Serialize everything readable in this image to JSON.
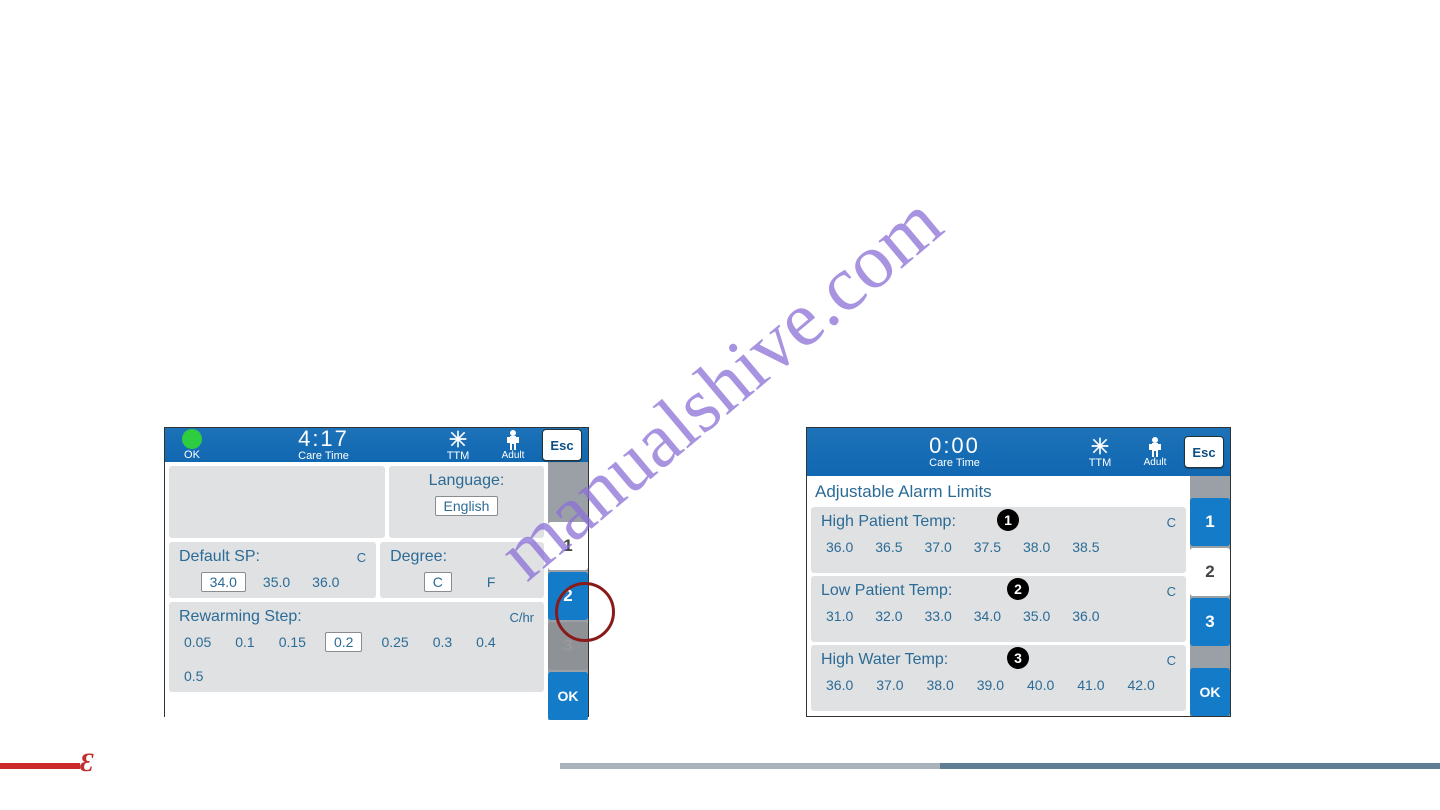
{
  "watermark": "manualshive.com",
  "device1": {
    "status": "OK",
    "care_time_value": "4:17",
    "care_time_label": "Care Time",
    "mode": "TTM",
    "patient_mode": "Adult",
    "esc": "Esc",
    "language_label": "Language:",
    "language_value": "English",
    "default_sp": {
      "label": "Default SP:",
      "unit": "C",
      "options": [
        "34.0",
        "35.0",
        "36.0"
      ],
      "selected": "34.0"
    },
    "degree": {
      "label": "Degree:",
      "options": [
        "C",
        "F"
      ],
      "selected": "C"
    },
    "rewarm": {
      "label": "Rewarming Step:",
      "unit": "C/hr",
      "options": [
        "0.05",
        "0.1",
        "0.15",
        "0.2",
        "0.25",
        "0.3",
        "0.4",
        "0.5"
      ],
      "selected": "0.2"
    },
    "tabs": [
      "1",
      "2",
      "3"
    ],
    "active_tab": "2",
    "ok": "OK"
  },
  "device2": {
    "care_time_value": "0:00",
    "care_time_label": "Care Time",
    "mode": "TTM",
    "patient_mode": "Adult",
    "esc": "Esc",
    "section_title": "Adjustable Alarm Limits",
    "high_patient": {
      "label": "High Patient Temp:",
      "unit": "C",
      "options": [
        "36.0",
        "36.5",
        "37.0",
        "37.5",
        "38.0",
        "38.5"
      ],
      "marker": "1"
    },
    "low_patient": {
      "label": "Low Patient Temp:",
      "unit": "C",
      "options": [
        "31.0",
        "32.0",
        "33.0",
        "34.0",
        "35.0",
        "36.0"
      ],
      "marker": "2"
    },
    "high_water": {
      "label": "High Water Temp:",
      "unit": "C",
      "options": [
        "36.0",
        "37.0",
        "38.0",
        "39.0",
        "40.0",
        "41.0",
        "42.0"
      ],
      "marker": "3"
    },
    "tabs": [
      "1",
      "2",
      "3"
    ],
    "active_tab": "2",
    "ok": "OK"
  }
}
